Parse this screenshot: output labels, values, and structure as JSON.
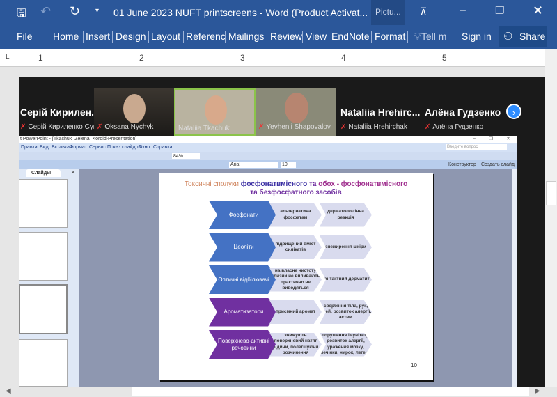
{
  "word": {
    "title": "01 June 2023 NUFT printscreens - Word (Product Activat...",
    "context_tab": "Pictu...",
    "tabs": [
      "File",
      "Home",
      "Insert",
      "Design",
      "Layout",
      "Referenc",
      "Mailings",
      "Review",
      "View",
      "EndNote",
      "Format"
    ],
    "tell_me": "Tell m",
    "sign_in": "Sign in",
    "share": "Share",
    "ruler": [
      "1",
      "2",
      "3",
      "4",
      "5"
    ]
  },
  "zoom": {
    "big_names": [
      "Серій Кирилен...",
      "Nataliia Hrehirc...",
      "Алёна Гудзенко"
    ],
    "participants": [
      "Серій Кириленко Сум...",
      "Oksana Nychyk",
      "Nataliia Tkachuk",
      "Yevhenii Shapovalov",
      "Nataliia Hrehirchak",
      "Алёна Гудзенко"
    ]
  },
  "ppt": {
    "title": "t PowerPoint - [Tkachuk_Zelena_Koroid-Presentation]",
    "menu": [
      "Правка",
      "Вид",
      "Вставка",
      "Формат",
      "Сервис",
      "Показ слайдов",
      "Окно",
      "Справка"
    ],
    "zoom": "84%",
    "font": "Arial",
    "size": "10",
    "help_placeholder": "Введите вопрос",
    "designer": "Конструктор",
    "new_slide": "Создать слайд",
    "pane_tab": "Слайды"
  },
  "slide": {
    "title_a": "Токсичні сполуки ",
    "title_b": "фосфонатвмісного",
    "title_c": " та ",
    "title_d": "обох - фосфонатвмісного",
    "title_e": "та безфосфатного засобів",
    "number": "10",
    "rows": [
      {
        "main": "Фосфонати",
        "a": "альтернатива фосфатам",
        "b": "дерматоло-гічна реакція"
      },
      {
        "main": "Цеоліти",
        "a": "підвищений вміст силікатів",
        "b": "знежирення шкіри"
      },
      {
        "main": "Оптичні відбілювачі",
        "a": "на власне чистоту білизни не впливають; практично не виводяться",
        "b": "контактний дерматит"
      },
      {
        "main": "Ароматизатори",
        "a": "приємний аромат",
        "b": "свербіння тіла, рук, очей, розвиток алергії, астми"
      },
      {
        "main": "Поверхнево-активні речовини",
        "a": "знижують поверхневий натяг рідини, полегшуючи розчинення",
        "b": "порушення імунітету, розвиток алергії, ураження мозку, печінки, нирок, легень"
      }
    ]
  }
}
